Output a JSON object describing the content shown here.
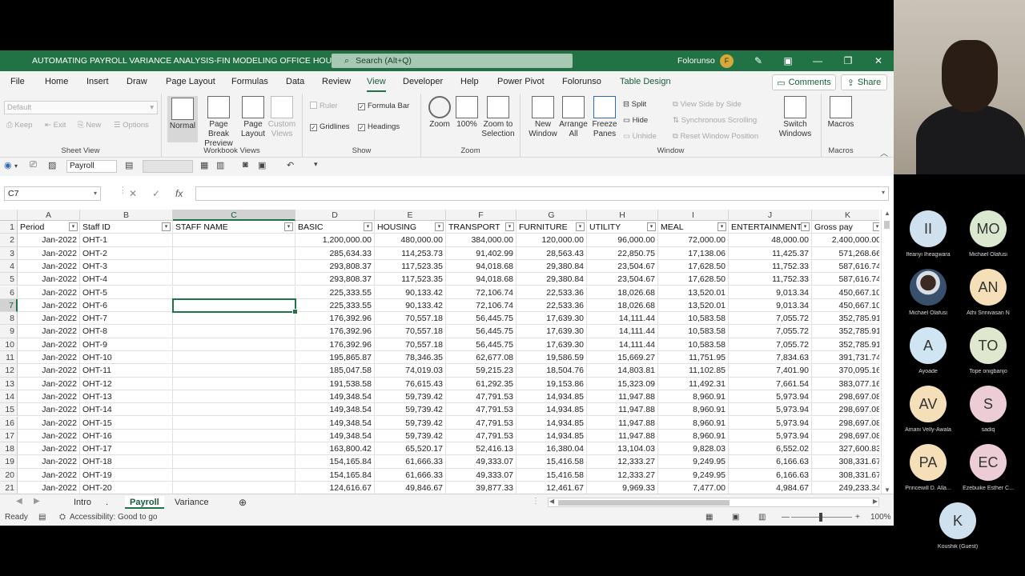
{
  "titlebar": {
    "title": "AUTOMATING PAYROLL VARIANCE ANALYSIS-FIN MODELING OFFICE HOURS ▾",
    "search_placeholder": "Search (Alt+Q)",
    "user_name": "Folorunso",
    "user_initial": "F"
  },
  "tabs": [
    "File",
    "Home",
    "Insert",
    "Draw",
    "Page Layout",
    "Formulas",
    "Data",
    "Review",
    "View",
    "Developer",
    "Help",
    "Power Pivot",
    "Folorunso",
    "Table Design"
  ],
  "active_tab": "View",
  "comments_label": "Comments",
  "share_label": "Share",
  "ribbon": {
    "sheet_view": {
      "label": "Sheet View",
      "dropdown_value": "Default",
      "keep": "Keep",
      "exit": "Exit",
      "new": "New",
      "options": "Options"
    },
    "workbook_views": {
      "label": "Workbook Views",
      "normal": "Normal",
      "page_break": "Page Break Preview",
      "page_layout": "Page Layout",
      "custom_views": "Custom Views"
    },
    "show": {
      "label": "Show",
      "ruler": "Ruler",
      "formula_bar": "Formula Bar",
      "gridlines": "Gridlines",
      "headings": "Headings"
    },
    "zoom": {
      "label": "Zoom",
      "zoom": "Zoom",
      "hundred": "100%",
      "zoom_sel": "Zoom to Selection"
    },
    "window": {
      "label": "Window",
      "new_window": "New Window",
      "arrange_all": "Arrange All",
      "freeze": "Freeze Panes",
      "split": "Split",
      "hide": "Hide",
      "unhide": "Unhide",
      "side_by_side": "View Side by Side",
      "sync_scroll": "Synchronous Scrolling",
      "reset_pos": "Reset Window Position",
      "switch": "Switch Windows"
    },
    "macros": {
      "label": "Macros",
      "macros": "Macros"
    }
  },
  "qat": {
    "sheet_name": "Payroll"
  },
  "formula_bar": {
    "name_box": "C7",
    "cancel": "✕",
    "enter": "✓",
    "fx": "fx",
    "content": ""
  },
  "columns": [
    "A",
    "B",
    "C",
    "D",
    "E",
    "F",
    "G",
    "H",
    "I",
    "J",
    "K"
  ],
  "headers": [
    "Period",
    "Staff ID",
    "STAFF NAME",
    "BASIC",
    "HOUSING",
    "TRANSPORT",
    "FURNITURE",
    "UTILITY",
    "MEAL",
    "ENTERTAINMENT",
    "Gross pay"
  ],
  "rows": [
    [
      "Jan-2022",
      "OHT-1",
      "",
      "1,200,000.00",
      "480,000.00",
      "384,000.00",
      "120,000.00",
      "96,000.00",
      "72,000.00",
      "48,000.00",
      "2,400,000.00"
    ],
    [
      "Jan-2022",
      "OHT-2",
      "",
      "285,634.33",
      "114,253.73",
      "91,402.99",
      "28,563.43",
      "22,850.75",
      "17,138.06",
      "11,425.37",
      "571,268.66"
    ],
    [
      "Jan-2022",
      "OHT-3",
      "",
      "293,808.37",
      "117,523.35",
      "94,018.68",
      "29,380.84",
      "23,504.67",
      "17,628.50",
      "11,752.33",
      "587,616.74"
    ],
    [
      "Jan-2022",
      "OHT-4",
      "",
      "293,808.37",
      "117,523.35",
      "94,018.68",
      "29,380.84",
      "23,504.67",
      "17,628.50",
      "11,752.33",
      "587,616.74"
    ],
    [
      "Jan-2022",
      "OHT-5",
      "",
      "225,333.55",
      "90,133.42",
      "72,106.74",
      "22,533.36",
      "18,026.68",
      "13,520.01",
      "9,013.34",
      "450,667.10"
    ],
    [
      "Jan-2022",
      "OHT-6",
      "",
      "225,333.55",
      "90,133.42",
      "72,106.74",
      "22,533.36",
      "18,026.68",
      "13,520.01",
      "9,013.34",
      "450,667.10"
    ],
    [
      "Jan-2022",
      "OHT-7",
      "",
      "176,392.96",
      "70,557.18",
      "56,445.75",
      "17,639.30",
      "14,111.44",
      "10,583.58",
      "7,055.72",
      "352,785.91"
    ],
    [
      "Jan-2022",
      "OHT-8",
      "",
      "176,392.96",
      "70,557.18",
      "56,445.75",
      "17,639.30",
      "14,111.44",
      "10,583.58",
      "7,055.72",
      "352,785.91"
    ],
    [
      "Jan-2022",
      "OHT-9",
      "",
      "176,392.96",
      "70,557.18",
      "56,445.75",
      "17,639.30",
      "14,111.44",
      "10,583.58",
      "7,055.72",
      "352,785.91"
    ],
    [
      "Jan-2022",
      "OHT-10",
      "",
      "195,865.87",
      "78,346.35",
      "62,677.08",
      "19,586.59",
      "15,669.27",
      "11,751.95",
      "7,834.63",
      "391,731.74"
    ],
    [
      "Jan-2022",
      "OHT-11",
      "",
      "185,047.58",
      "74,019.03",
      "59,215.23",
      "18,504.76",
      "14,803.81",
      "11,102.85",
      "7,401.90",
      "370,095.16"
    ],
    [
      "Jan-2022",
      "OHT-12",
      "",
      "191,538.58",
      "76,615.43",
      "61,292.35",
      "19,153.86",
      "15,323.09",
      "11,492.31",
      "7,661.54",
      "383,077.16"
    ],
    [
      "Jan-2022",
      "OHT-13",
      "",
      "149,348.54",
      "59,739.42",
      "47,791.53",
      "14,934.85",
      "11,947.88",
      "8,960.91",
      "5,973.94",
      "298,697.08"
    ],
    [
      "Jan-2022",
      "OHT-14",
      "",
      "149,348.54",
      "59,739.42",
      "47,791.53",
      "14,934.85",
      "11,947.88",
      "8,960.91",
      "5,973.94",
      "298,697.08"
    ],
    [
      "Jan-2022",
      "OHT-15",
      "",
      "149,348.54",
      "59,739.42",
      "47,791.53",
      "14,934.85",
      "11,947.88",
      "8,960.91",
      "5,973.94",
      "298,697.08"
    ],
    [
      "Jan-2022",
      "OHT-16",
      "",
      "149,348.54",
      "59,739.42",
      "47,791.53",
      "14,934.85",
      "11,947.88",
      "8,960.91",
      "5,973.94",
      "298,697.08"
    ],
    [
      "Jan-2022",
      "OHT-17",
      "",
      "163,800.42",
      "65,520.17",
      "52,416.13",
      "16,380.04",
      "13,104.03",
      "9,828.03",
      "6,552.02",
      "327,600.83"
    ],
    [
      "Jan-2022",
      "OHT-18",
      "",
      "154,165.84",
      "61,666.33",
      "49,333.07",
      "15,416.58",
      "12,333.27",
      "9,249.95",
      "6,166.63",
      "308,331.67"
    ],
    [
      "Jan-2022",
      "OHT-19",
      "",
      "154,165.84",
      "61,666.33",
      "49,333.07",
      "15,416.58",
      "12,333.27",
      "9,249.95",
      "6,166.63",
      "308,331.67"
    ],
    [
      "Jan-2022",
      "OHT-20",
      "",
      "124,616.67",
      "49,846.67",
      "39,877.33",
      "12,461.67",
      "9,969.33",
      "7,477.00",
      "4,984.67",
      "249,233.34"
    ]
  ],
  "sheet_tabs": [
    "Intro",
    ".",
    "Payroll",
    "Variance"
  ],
  "active_sheet": "Payroll",
  "status": {
    "ready": "Ready",
    "accessibility": "Accessibility: Good to go",
    "zoom": "100%"
  },
  "participants": [
    {
      "initials": "II",
      "name": "Ifeanyi Iheagwara",
      "color": "#cfe0ef"
    },
    {
      "initials": "MO",
      "name": "Michael Olafusi",
      "color": "#d9e8cf"
    },
    {
      "initials": "",
      "name": "Michael Olafusi",
      "color": "#5a6a7a"
    },
    {
      "initials": "AN",
      "name": "Athi Srinivasan N",
      "color": "#f4dfb8"
    },
    {
      "initials": "A",
      "name": "Ayoade",
      "color": "#cfe6f2"
    },
    {
      "initials": "TO",
      "name": "Tope onigbanjo",
      "color": "#dfe8cf"
    },
    {
      "initials": "AV",
      "name": "Amani Velly-Awala",
      "color": "#f4dfb8"
    },
    {
      "initials": "S",
      "name": "sadiq",
      "color": "#eccdd6"
    },
    {
      "initials": "PA",
      "name": "Princewill D. Alla...",
      "color": "#f4dfb8"
    },
    {
      "initials": "EC",
      "name": "Ezebuike Esther C...",
      "color": "#eccdd6"
    },
    {
      "initials": "K",
      "name": "Koushik (Guest)",
      "color": "#cfe0ef"
    }
  ]
}
